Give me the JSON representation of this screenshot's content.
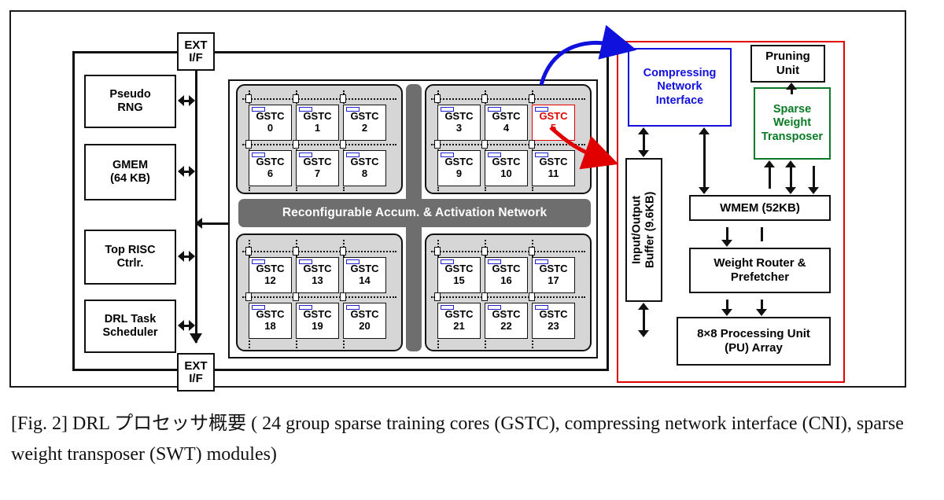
{
  "figure": {
    "caption": "[Fig. 2] DRL プロセッサ概要 ( 24 group sparse training cores (GSTC), compressing network interface (CNI), sparse weight transposer (SWT) modules)"
  },
  "colors": {
    "highlight_red": "#e00000",
    "cni_blue": "#1111dd",
    "swt_green": "#0a7a26",
    "network_gray": "#6e6e6e",
    "group_gray": "#d6d6d6"
  },
  "ext_if": {
    "top": {
      "line1": "EXT",
      "line2": "I/F"
    },
    "bottom": {
      "line1": "EXT",
      "line2": "I/F"
    }
  },
  "left_column": {
    "blocks": [
      {
        "line1": "Pseudo",
        "line2": "RNG"
      },
      {
        "line1": "GMEM",
        "line2": "(64 KB)"
      },
      {
        "line1": "Top RISC",
        "line2": "Ctrlr."
      },
      {
        "line1": "DRL Task",
        "line2": "Scheduler"
      }
    ]
  },
  "core_array": {
    "network_label": "Reconfigurable Accum. & Activation Network",
    "core_prefix": "GSTC",
    "selected_core": "5",
    "groups": [
      {
        "ids": [
          "0",
          "1",
          "2",
          "6",
          "7",
          "8"
        ]
      },
      {
        "ids": [
          "3",
          "4",
          "5",
          "9",
          "10",
          "11"
        ]
      },
      {
        "ids": [
          "12",
          "13",
          "14",
          "18",
          "19",
          "20"
        ]
      },
      {
        "ids": [
          "15",
          "16",
          "17",
          "21",
          "22",
          "23"
        ]
      }
    ]
  },
  "right_panel": {
    "cni": {
      "line1": "Compressing",
      "line2": "Network",
      "line3": "Interface"
    },
    "pruning": {
      "line1": "Pruning",
      "line2": "Unit"
    },
    "swt": {
      "line1": "Sparse",
      "line2": "Weight",
      "line3": "Transposer"
    },
    "io_buffer": {
      "line1": "Input/Output",
      "line2": "Buffer (9.6KB)"
    },
    "wmem": {
      "label": "WMEM (52KB)"
    },
    "weight_router": {
      "line1": "Weight Router &",
      "line2": "Prefetcher"
    },
    "pu_array": {
      "line1": "8×8 Processing Unit",
      "line2": "(PU) Array"
    }
  }
}
